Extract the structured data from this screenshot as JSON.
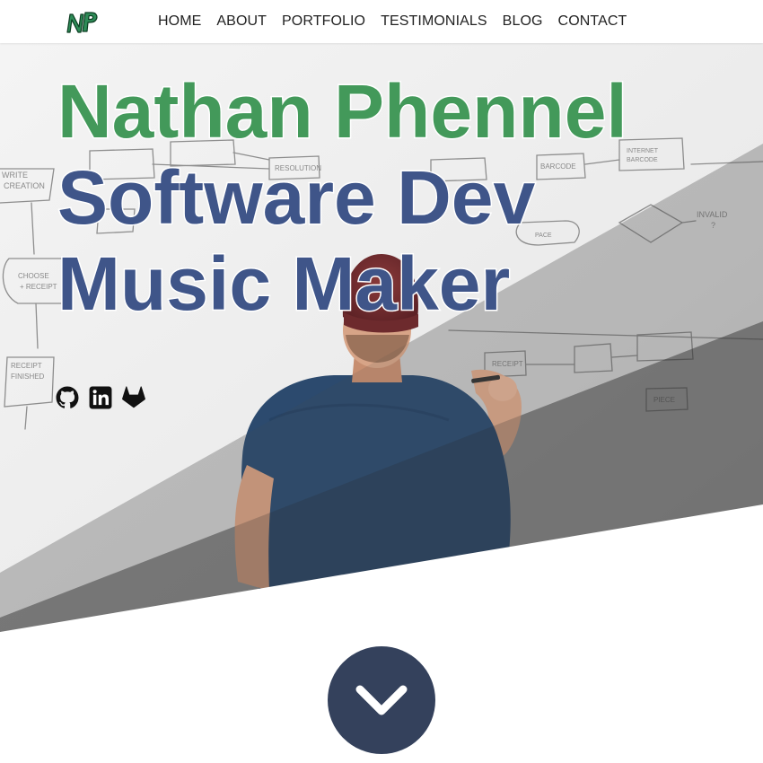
{
  "brand": {
    "logo_text": "NP",
    "logo_color": "#2e8b57"
  },
  "nav": {
    "items": [
      {
        "label": "HOME"
      },
      {
        "label": "ABOUT"
      },
      {
        "label": "PORTFOLIO"
      },
      {
        "label": "TESTIMONIALS"
      },
      {
        "label": "BLOG"
      },
      {
        "label": "CONTACT"
      }
    ]
  },
  "hero": {
    "name": "Nathan Phennel",
    "role_1": "Software Dev",
    "role_2": "Music Maker",
    "name_color": "#43995a",
    "role_color": "#3f5589",
    "background_image": "man-in-beanie-at-whiteboard"
  },
  "socials": [
    {
      "icon": "github-icon"
    },
    {
      "icon": "linkedin-icon"
    },
    {
      "icon": "gitlab-icon"
    }
  ],
  "scroll_button": {
    "icon": "chevron-down-icon",
    "color": "#34415c"
  }
}
